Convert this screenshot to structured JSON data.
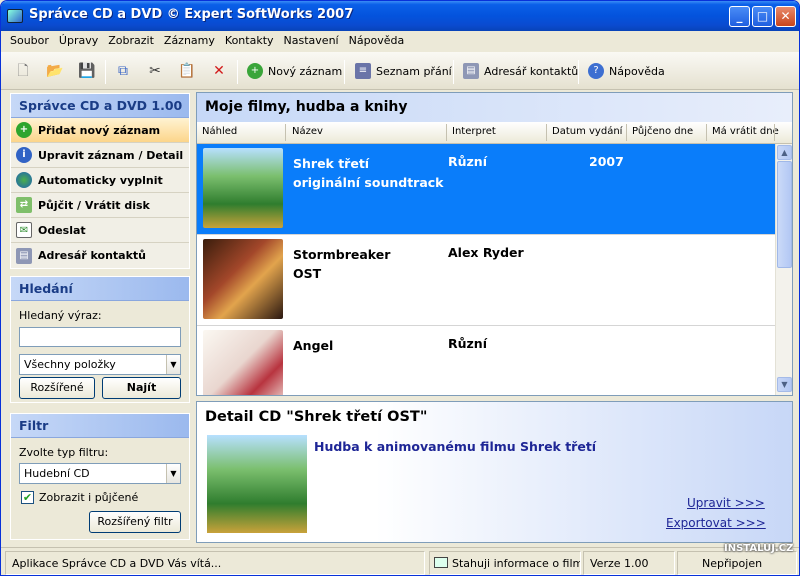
{
  "window": {
    "title": "Správce CD a DVD © Expert SoftWorks 2007"
  },
  "menu": [
    "Soubor",
    "Úpravy",
    "Zobrazit",
    "Záznamy",
    "Kontakty",
    "Nastavení",
    "Nápověda"
  ],
  "toolbar": {
    "new_record": "Nový záznam",
    "wishlist": "Seznam přání",
    "contacts": "Adresář kontaktů",
    "help": "Nápověda"
  },
  "sidebar": {
    "header": "Správce CD a DVD 1.00",
    "items": [
      "Přidat nový záznam",
      "Upravit záznam / Detail",
      "Automaticky vyplnit",
      "Půjčit / Vrátit disk",
      "Odeslat",
      "Adresář kontaktů"
    ]
  },
  "search": {
    "header": "Hledání",
    "label": "Hledaný výraz:",
    "value": "",
    "scope": "Všechny položky",
    "advanced": "Rozšířené",
    "find": "Najít"
  },
  "filter": {
    "header": "Filtr",
    "label": "Zvolte typ filtru:",
    "type": "Hudební CD",
    "show_lent": "Zobrazit i půjčené",
    "show_lent_checked": true,
    "advanced": "Rozšířený filtr"
  },
  "main": {
    "title": "Moje filmy, hudba a knihy",
    "columns": [
      "Náhled",
      "Název",
      "Interpret",
      "Datum vydání",
      "Půjčeno dne",
      "Má vrátit dne"
    ],
    "rows": [
      {
        "name1": "Shrek třetí",
        "name2": "originální soundtrack",
        "artist": "Různí",
        "year": "2007",
        "selected": true,
        "cover": "shrek-cover"
      },
      {
        "name1": "Stormbreaker",
        "name2": "OST",
        "artist": "Alex Ryder",
        "year": "",
        "selected": false,
        "cover": "stormbreaker-cover"
      },
      {
        "name1": "Angel",
        "name2": "",
        "artist": "Různí",
        "year": "",
        "selected": false,
        "cover": "angel-cover"
      }
    ]
  },
  "detail": {
    "title": "Detail CD \"Shrek třetí OST\"",
    "description": "Hudba k animovanému filmu Shrek třetí",
    "edit": "Upravit >>>",
    "export": "Exportovat >>>"
  },
  "status": {
    "welcome": "Aplikace Správce CD a DVD Vás vítá...",
    "downloading": "Stahuji informace o filmu...",
    "version": "Verze 1.00",
    "connection": "Nepřipojen"
  },
  "watermark": "INSTALUJ.CZ",
  "colors": {
    "accent": "#0a7dfa",
    "panel_header": "#9bb9ee",
    "titlebar": "#0453dd"
  }
}
